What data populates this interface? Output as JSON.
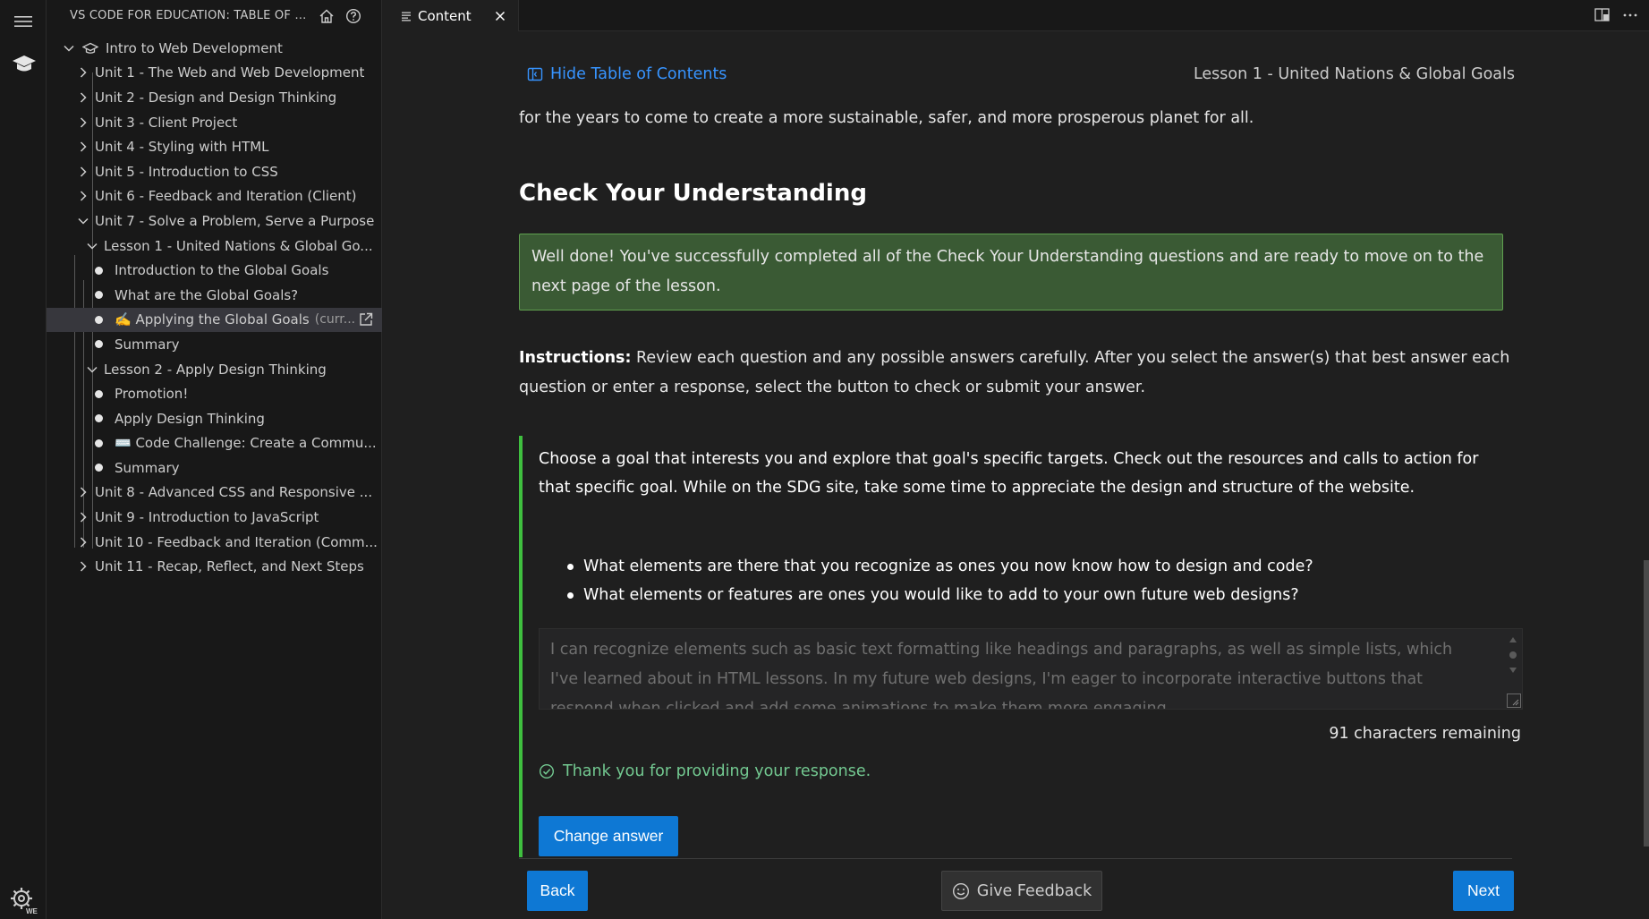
{
  "sidebar": {
    "title": "VS CODE FOR EDUCATION: TABLE OF CON...",
    "root": "Intro to Web Development",
    "units_before": [
      "Unit 1 - The Web and Web Development",
      "Unit 2 - Design and Design Thinking",
      "Unit 3 - Client Project",
      "Unit 4 - Styling with HTML",
      "Unit 5 - Introduction to CSS",
      "Unit 6 - Feedback and Iteration (Client)"
    ],
    "unit7": "Unit 7 - Solve a Problem, Serve a Purpose",
    "lesson1": "Lesson 1 - United Nations & Global Go...",
    "lesson1_items": [
      "Introduction to the Global Goals",
      "What are the Global Goals?"
    ],
    "current_item": "✍️ Applying the Global Goals",
    "current_suffix": "(curr...",
    "lesson1_summary": "Summary",
    "lesson2": "Lesson 2 - Apply Design Thinking",
    "lesson2_items": [
      "Promotion!",
      "Apply Design Thinking",
      "⌨️ Code Challenge: Create a Commu...",
      "Summary"
    ],
    "units_after": [
      "Unit 8 - Advanced CSS and Responsive ...",
      "Unit 9 - Introduction to JavaScript",
      "Unit 10 - Feedback and Iteration (Comm...",
      "Unit 11 - Recap, Reflect, and Next Steps"
    ]
  },
  "tab": {
    "label": "Content"
  },
  "content": {
    "hide_toc": "Hide Table of Contents",
    "lesson_title": "Lesson 1 - United Nations & Global Goals",
    "lead": "for the years to come to create a more sustainable, safer, and more prosperous planet for all.",
    "heading": "Check Your Understanding",
    "success": "Well done! You've successfully completed all of the Check Your Understanding questions and are ready to move on to the next page of the lesson.",
    "instructions_label": "Instructions:",
    "instructions_text": " Review each question and any possible answers carefully. After you select the answer(s) that best answer each question or enter a response, select the button to check or submit your answer.",
    "question": "Choose a goal that interests you and explore that goal's specific targets. Check out the resources and calls to action for that specific goal. While on the SDG site, take some time to appreciate the design and structure of the website.",
    "bullets": [
      "What elements are there that you recognize as ones you now know how to design and code?",
      "What elements or features are ones you would like to add to your own future web designs?"
    ],
    "answer": "I can recognize elements such as basic text formatting like headings and paragraphs, as well as simple lists, which I've learned about in HTML lessons. In my future web designs, I'm eager to incorporate interactive buttons that respond when clicked and add some animations to make them more engaging.",
    "remaining": "91 characters remaining",
    "thanks": "Thank you for providing your response.",
    "change_answer": "Change answer",
    "back": "Back",
    "feedback": "Give Feedback",
    "next": "Next"
  },
  "colors": {
    "accent": "#0e78d4",
    "link": "#3794ff",
    "success_bg": "#3a5a34",
    "success_border": "#5fa04f",
    "question_bar": "#3fbf3f",
    "thanks": "#73c991"
  }
}
